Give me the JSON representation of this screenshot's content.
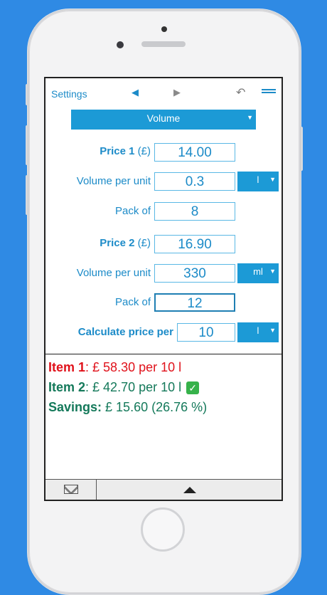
{
  "nav": {
    "settings": "Settings",
    "prev": "◀",
    "next": "▶",
    "undo": "↶"
  },
  "mode": {
    "value": "Volume",
    "caret": "▼"
  },
  "item1": {
    "price_label": "Price 1",
    "price_currency": "(£)",
    "price_value": "14.00",
    "volume_label": "Volume per unit",
    "volume_value": "0.3",
    "volume_unit": "l",
    "pack_label": "Pack of",
    "pack_value": "8"
  },
  "item2": {
    "price_label": "Price 2",
    "price_currency": "(£)",
    "price_value": "16.90",
    "volume_label": "Volume per unit",
    "volume_value": "330",
    "volume_unit": "ml",
    "pack_label": "Pack of",
    "pack_value": "12"
  },
  "calc": {
    "label": "Calculate price per",
    "value": "10",
    "unit": "l"
  },
  "results": {
    "item1_label": "Item 1",
    "item1_text": ": £ 58.30 per 10 l",
    "item2_label": "Item 2",
    "item2_text": ": £ 42.70 per 10 l",
    "savings_label": "Savings:",
    "savings_text": " £ 15.60 (26.76 %)",
    "check_glyph": "✓"
  },
  "colors": {
    "accent": "#1c9ad6",
    "worse": "#e0121b",
    "better": "#14795a",
    "background": "#2f8ae4"
  },
  "icons": {
    "mail": "mail-icon",
    "up": "chevron-up-icon",
    "check": "check-icon"
  }
}
